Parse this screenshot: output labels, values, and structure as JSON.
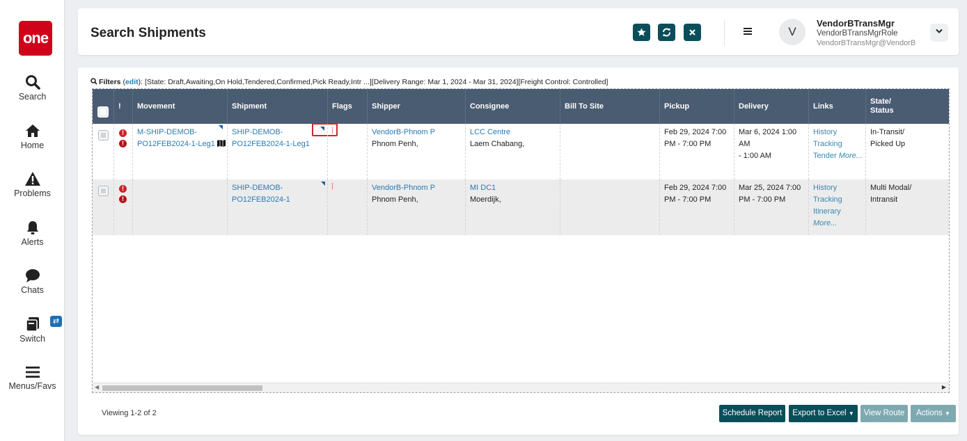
{
  "sidebar": {
    "logo": "one",
    "items": [
      {
        "label": "Search",
        "icon": "search-icon"
      },
      {
        "label": "Home",
        "icon": "home-icon"
      },
      {
        "label": "Problems",
        "icon": "warning-icon"
      },
      {
        "label": "Alerts",
        "icon": "bell-icon"
      },
      {
        "label": "Chats",
        "icon": "chat-icon"
      },
      {
        "label": "Switch",
        "icon": "switch-icon"
      },
      {
        "label": "Menus/Favs",
        "icon": "hamburger-icon"
      }
    ],
    "switch_badge": "⇄"
  },
  "header": {
    "title": "Search Shipments",
    "user_initial": "V",
    "user_name": "VendorBTransMgr",
    "user_role": "VendorBTransMgrRole",
    "user_email": "VendorBTransMgr@VendorB"
  },
  "filters": {
    "label": "Filters",
    "edit": "edit",
    "text": ":  [State: Draft,Awaiting,On Hold,Tendered,Confirmed,Pick Ready,Intr ...][Delivery Range: Mar 1, 2024 - Mar 31, 2024][Freight Control: Controlled]"
  },
  "table": {
    "columns": {
      "alert": "!",
      "movement": "Movement",
      "shipment": "Shipment",
      "flags": "Flags",
      "shipper": "Shipper",
      "consignee": "Consignee",
      "bill_to": "Bill To Site",
      "pickup": "Pickup",
      "delivery": "Delivery",
      "links": "Links",
      "state_1": "State/",
      "state_2": "Status"
    },
    "rows": [
      {
        "movement_1": "M-SHIP-DEMOB-",
        "movement_2": "PO12FEB2024-1-Leg1",
        "shipment_1": "SHIP-DEMOB-",
        "shipment_2": "PO12FEB2024-1-Leg1",
        "flag": "Ī",
        "shipper_link": "VendorB-Phnom P",
        "shipper_city": "Phnom Penh,",
        "consignee_link": "LCC Centre",
        "consignee_city": "Laem Chabang,",
        "bill_to": "",
        "pickup_1": "Feb 29, 2024 7:00",
        "pickup_2": "PM - 7:00 PM",
        "delivery_1": "Mar 6, 2024 1:00 AM",
        "delivery_2": "- 1:00 AM",
        "link_1": "History",
        "link_2": "Tracking",
        "link_3": "Tender",
        "link_more": "More...",
        "state_1": "In-Transit/",
        "state_2": "Picked Up"
      },
      {
        "movement_1": "",
        "movement_2": "",
        "shipment_1": "SHIP-DEMOB-",
        "shipment_2": "PO12FEB2024-1",
        "flag": "Ī",
        "shipper_link": "VendorB-Phnom P",
        "shipper_city": "Phnom Penh,",
        "consignee_link": "MI DC1",
        "consignee_city": "Moerdijk,",
        "bill_to": "",
        "pickup_1": "Feb 29, 2024 7:00",
        "pickup_2": "PM - 7:00 PM",
        "delivery_1": "Mar 25, 2024 7:00",
        "delivery_2": "PM - 7:00 PM",
        "link_1": "History",
        "link_2": "Tracking",
        "link_3": "Itinerary",
        "link_more": "More...",
        "state_1": "Multi Modal/",
        "state_2": "Intransit"
      }
    ]
  },
  "footer": {
    "viewing": "Viewing 1-2 of 2",
    "schedule_report": "Schedule Report",
    "export_excel": "Export to Excel",
    "view_route": "View Route",
    "actions": "Actions"
  },
  "colors": {
    "brand_red": "#d0021b",
    "header_teal": "#0b4e5a",
    "table_header": "#4a5c72",
    "link_blue": "#2a7ab0"
  }
}
